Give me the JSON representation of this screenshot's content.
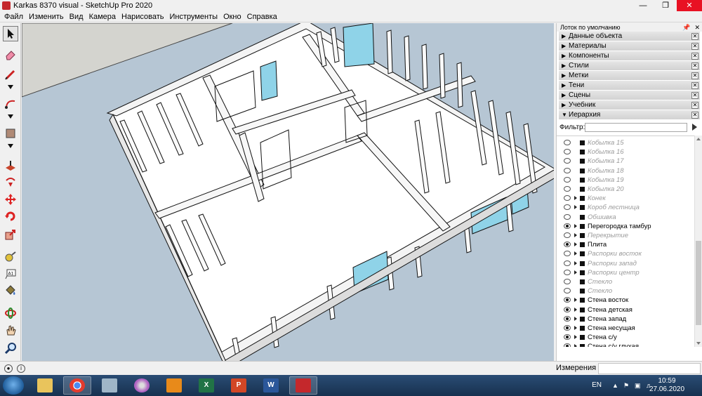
{
  "window": {
    "title": "Karkas 8370 visual - SketchUp Pro 2020"
  },
  "menu": [
    "Файл",
    "Изменить",
    "Вид",
    "Камера",
    "Нарисовать",
    "Инструменты",
    "Окно",
    "Справка"
  ],
  "tray": {
    "title": "Лоток по умолчанию",
    "panels": [
      {
        "label": "Данные объекта",
        "expanded": false
      },
      {
        "label": "Материалы",
        "expanded": false
      },
      {
        "label": "Компоненты",
        "expanded": false
      },
      {
        "label": "Стили",
        "expanded": false
      },
      {
        "label": "Метки",
        "expanded": false
      },
      {
        "label": "Тени",
        "expanded": false
      },
      {
        "label": "Сцены",
        "expanded": false
      },
      {
        "label": "Учебник",
        "expanded": false
      },
      {
        "label": "Иерархия",
        "expanded": true
      }
    ],
    "filter_label": "Фильтр:",
    "filter_value": "",
    "outliner": [
      {
        "label": "Кобылка 15",
        "visible": false,
        "expandable": false
      },
      {
        "label": "Кобылка 16",
        "visible": false,
        "expandable": false
      },
      {
        "label": "Кобылка 17",
        "visible": false,
        "expandable": false
      },
      {
        "label": "Кобылка 18",
        "visible": false,
        "expandable": false
      },
      {
        "label": "Кобылка 19",
        "visible": false,
        "expandable": false
      },
      {
        "label": "Кобылка 20",
        "visible": false,
        "expandable": false
      },
      {
        "label": "Конек",
        "visible": false,
        "expandable": true
      },
      {
        "label": "Короб лестница",
        "visible": false,
        "expandable": true
      },
      {
        "label": "Обшивка",
        "visible": false,
        "expandable": false
      },
      {
        "label": "Перегородка тамбур",
        "visible": true,
        "expandable": true
      },
      {
        "label": "Перекрытие",
        "visible": false,
        "expandable": true
      },
      {
        "label": "Плита",
        "visible": true,
        "expandable": true
      },
      {
        "label": "Распорки восток",
        "visible": false,
        "expandable": true
      },
      {
        "label": "Распорки запад",
        "visible": false,
        "expandable": true
      },
      {
        "label": "Распорки центр",
        "visible": false,
        "expandable": true
      },
      {
        "label": "Стекло",
        "visible": false,
        "expandable": false
      },
      {
        "label": "Стекло",
        "visible": false,
        "expandable": false
      },
      {
        "label": "Стена восток",
        "visible": true,
        "expandable": true
      },
      {
        "label": "Стена детская",
        "visible": true,
        "expandable": true
      },
      {
        "label": "Стена запад",
        "visible": true,
        "expandable": true
      },
      {
        "label": "Стена несущая",
        "visible": true,
        "expandable": true
      },
      {
        "label": "Стена с/у",
        "visible": true,
        "expandable": true
      },
      {
        "label": "Стена с/у глухая",
        "visible": true,
        "expandable": true
      }
    ]
  },
  "status": {
    "measurements_label": "Измерения",
    "measurements_value": ""
  },
  "taskbar": {
    "apps": [
      {
        "name": "explorer",
        "label": ""
      },
      {
        "name": "chrome",
        "label": ""
      },
      {
        "name": "calculator",
        "label": ""
      },
      {
        "name": "cd-burner",
        "label": ""
      },
      {
        "name": "media-player",
        "label": ""
      },
      {
        "name": "excel",
        "label": "X"
      },
      {
        "name": "powerpoint",
        "label": "P"
      },
      {
        "name": "word",
        "label": "W"
      },
      {
        "name": "sketchup",
        "label": ""
      }
    ],
    "language": "EN",
    "time": "10:59",
    "date": "27.06.2020"
  },
  "colors": {
    "viewport_bg": "#b6c6d4",
    "glass": "#8fd3e8",
    "close": "#e81123",
    "taskbar": "#1f3c60"
  }
}
